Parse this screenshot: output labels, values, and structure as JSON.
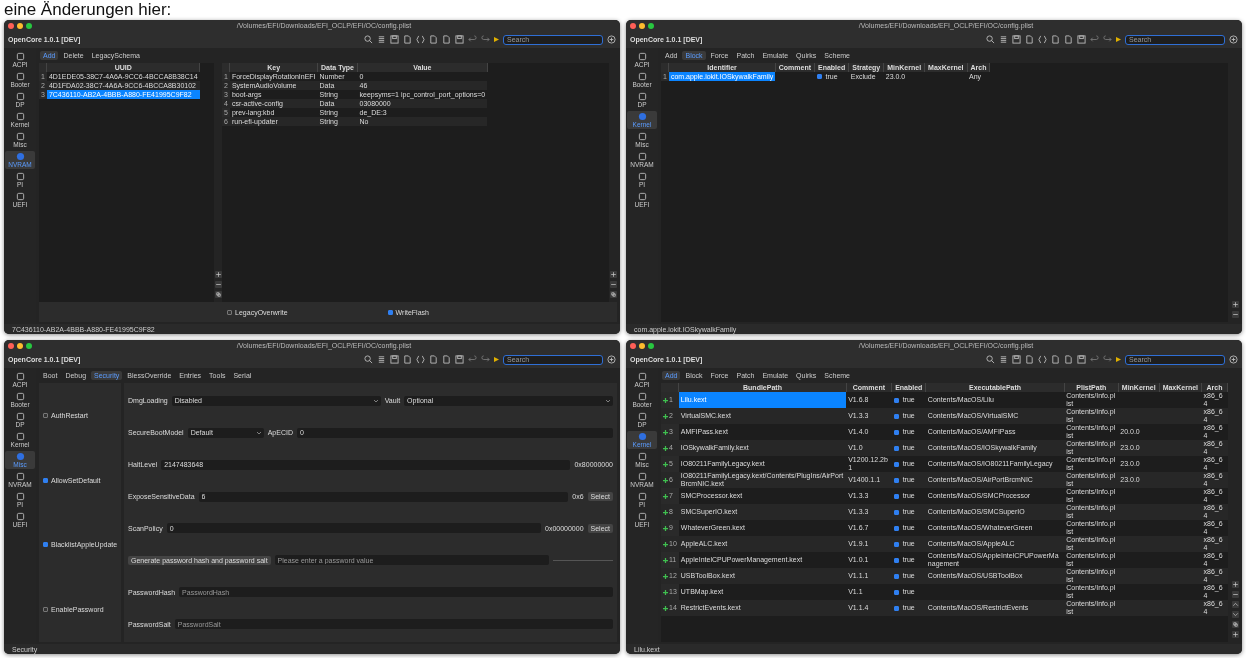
{
  "caption": "eine Änderungen hier:",
  "windows": [
    {
      "title": "/Volumes/EFI/Downloads/EFI_OCLP/EFI/OC/config.plist",
      "app_name": "OpenCore 1.0.1 [DEV]",
      "search_placeholder": "Search",
      "sidebar": [
        {
          "label": "ACPI",
          "selected": false
        },
        {
          "label": "Booter",
          "selected": false
        },
        {
          "label": "DP",
          "selected": false
        },
        {
          "label": "Kernel",
          "selected": false
        },
        {
          "label": "Misc",
          "selected": false
        },
        {
          "label": "NVRAM",
          "selected": true
        },
        {
          "label": "PI",
          "selected": false
        },
        {
          "label": "UEFI",
          "selected": false
        }
      ],
      "tabs": [
        {
          "label": "Add",
          "selected": true
        },
        {
          "label": "Delete",
          "selected": false
        },
        {
          "label": "LegacySchema",
          "selected": false
        }
      ],
      "kind": "nvram",
      "left_table": {
        "columns": [
          {
            "label": "UUID",
            "kind": "text"
          }
        ],
        "rows": [
          {
            "number": "1",
            "kind": "plain",
            "selected": false,
            "cells": [
              "4D1EDE05-38C7-4A6A-9CC6-4BCCA8B38C14"
            ]
          },
          {
            "number": "2",
            "kind": "plain",
            "selected": false,
            "cells": [
              "4D1FDA02-38C7-4A6A-9CC6-4BCCA8B30102"
            ]
          },
          {
            "number": "3",
            "kind": "plain",
            "selected": true,
            "cells": [
              "7C436110-AB2A-4BBB-A880-FE41995C9F82"
            ]
          }
        ]
      },
      "right_table": {
        "columns": [
          {
            "label": "Key",
            "kind": "text"
          },
          {
            "label": "Data Type",
            "kind": "text"
          },
          {
            "label": "Value",
            "kind": "text"
          }
        ],
        "rows": [
          {
            "number": "1",
            "kind": "plain",
            "selected": false,
            "cells": [
              "ForceDisplayRotationInEFI",
              "Number",
              "0"
            ]
          },
          {
            "number": "2",
            "kind": "plain",
            "selected": false,
            "cells": [
              "SystemAudioVolume",
              "Data",
              "46"
            ]
          },
          {
            "number": "3",
            "kind": "plain",
            "selected": false,
            "cells": [
              "boot-args",
              "String",
              "keepsyms=1 ipc_control_port_options=0"
            ]
          },
          {
            "number": "4",
            "kind": "plain",
            "selected": false,
            "cells": [
              "csr-active-config",
              "Data",
              "03080000"
            ]
          },
          {
            "number": "5",
            "kind": "plain",
            "selected": false,
            "cells": [
              "prev-lang:kbd",
              "String",
              "de_DE:3"
            ]
          },
          {
            "number": "6",
            "kind": "plain",
            "selected": false,
            "cells": [
              "run-efi-updater",
              "String",
              "No"
            ]
          }
        ]
      },
      "side_tools": [
        {
          "kind": "plus"
        },
        {
          "kind": "minus"
        },
        {
          "kind": "copy"
        }
      ],
      "footer_checks": [
        {
          "label": "LegacyOverwrite",
          "checked": false
        },
        {
          "label": "WriteFlash",
          "checked": true
        }
      ],
      "status": "7C436110-AB2A-4BBB-A880-FE41995C9F82"
    },
    {
      "title": "/Volumes/EFI/Downloads/EFI_OCLP/EFI/OC/config.plist",
      "app_name": "OpenCore 1.0.1 [DEV]",
      "search_placeholder": "Search",
      "sidebar": [
        {
          "label": "ACPI",
          "selected": false
        },
        {
          "label": "Booter",
          "selected": false
        },
        {
          "label": "DP",
          "selected": false
        },
        {
          "label": "Kernel",
          "selected": true
        },
        {
          "label": "Misc",
          "selected": false
        },
        {
          "label": "NVRAM",
          "selected": false
        },
        {
          "label": "PI",
          "selected": false
        },
        {
          "label": "UEFI",
          "selected": false
        }
      ],
      "tabs": [
        {
          "label": "Add",
          "selected": false
        },
        {
          "label": "Block",
          "selected": true
        },
        {
          "label": "Force",
          "selected": false
        },
        {
          "label": "Patch",
          "selected": false
        },
        {
          "label": "Emulate",
          "selected": false
        },
        {
          "label": "Quirks",
          "selected": false
        },
        {
          "label": "Scheme",
          "selected": false
        }
      ],
      "kind": "table",
      "table": {
        "columns": [
          {
            "label": "Identifier",
            "kind": "text"
          },
          {
            "label": "Comment",
            "kind": "text"
          },
          {
            "label": "Enabled",
            "kind": "check"
          },
          {
            "label": "Strategy",
            "kind": "text"
          },
          {
            "label": "MinKernel",
            "kind": "text"
          },
          {
            "label": "MaxKernel",
            "kind": "text"
          },
          {
            "label": "Arch",
            "kind": "text"
          }
        ],
        "rows": [
          {
            "number": "1",
            "kind": "plain",
            "selected": true,
            "checked": true,
            "cells": [
              "com.apple.iokit.IOSkywalkFamily",
              "",
              "true",
              "Exclude",
              "23.0.0",
              "",
              "Any"
            ]
          }
        ]
      },
      "side_tools": [
        {
          "kind": "plus"
        },
        {
          "kind": "minus"
        }
      ],
      "status": "com.apple.iokit.IOSkywalkFamily"
    },
    {
      "title": "/Volumes/EFI/Downloads/EFI_OCLP/EFI/OC/config.plist",
      "app_name": "OpenCore 1.0.1 [DEV]",
      "search_placeholder": "Search",
      "sidebar": [
        {
          "label": "ACPI",
          "selected": false
        },
        {
          "label": "Booter",
          "selected": false
        },
        {
          "label": "DP",
          "selected": false
        },
        {
          "label": "Kernel",
          "selected": false
        },
        {
          "label": "Misc",
          "selected": true
        },
        {
          "label": "NVRAM",
          "selected": false
        },
        {
          "label": "PI",
          "selected": false
        },
        {
          "label": "UEFI",
          "selected": false
        }
      ],
      "tabs": [
        {
          "label": "Boot",
          "selected": false
        },
        {
          "label": "Debug",
          "selected": false
        },
        {
          "label": "Security",
          "selected": true
        },
        {
          "label": "BlessOverride",
          "selected": false
        },
        {
          "label": "Entries",
          "selected": false
        },
        {
          "label": "Tools",
          "selected": false
        },
        {
          "label": "Serial",
          "selected": false
        }
      ],
      "kind": "form",
      "checks": [
        {
          "label": "AuthRestart",
          "checked": false
        },
        {
          "label": "AllowSetDefault",
          "checked": true
        },
        {
          "label": "BlacklistAppleUpdate",
          "checked": true
        },
        {
          "label": "EnablePassword",
          "checked": false
        }
      ],
      "form_rows": [
        [
          {
            "kind": "label",
            "text": "DmgLoading"
          },
          {
            "kind": "select",
            "text": "Disabled"
          },
          {
            "kind": "label",
            "text": "Vault"
          },
          {
            "kind": "select",
            "text": "Optional"
          }
        ],
        [
          {
            "kind": "label",
            "text": "SecureBootModel"
          },
          {
            "kind": "select_short",
            "text": "Default"
          },
          {
            "kind": "label",
            "text": "ApECID"
          },
          {
            "kind": "input",
            "text": "0"
          }
        ],
        [
          {
            "kind": "label",
            "text": "HaltLevel"
          },
          {
            "kind": "input",
            "text": "2147483648"
          },
          {
            "kind": "label",
            "text": "0x80000000"
          }
        ],
        [
          {
            "kind": "label",
            "text": "ExposeSensitiveData"
          },
          {
            "kind": "input",
            "text": "6"
          },
          {
            "kind": "label",
            "text": "0x6"
          },
          {
            "kind": "button",
            "text": "Select"
          }
        ],
        [
          {
            "kind": "label",
            "text": "ScanPolicy"
          },
          {
            "kind": "input",
            "text": "0"
          },
          {
            "kind": "label",
            "text": "0x00000000"
          },
          {
            "kind": "button",
            "text": "Select"
          }
        ],
        [
          {
            "kind": "button",
            "text": "Generate password hash and password salt"
          },
          {
            "kind": "input",
            "placeholder": "Please enter a password value"
          },
          {
            "kind": "rule"
          }
        ],
        [
          {
            "kind": "label",
            "text": "PasswordHash"
          },
          {
            "kind": "input",
            "placeholder": "PasswordHash"
          }
        ],
        [
          {
            "kind": "label",
            "text": "PasswordSalt"
          },
          {
            "kind": "input",
            "placeholder": "PasswordSalt"
          }
        ]
      ],
      "status": "Security"
    },
    {
      "title": "/Volumes/EFI/Downloads/EFI_OCLP/EFI/OC/config.plist",
      "app_name": "OpenCore 1.0.1 [DEV]",
      "search_placeholder": "Search",
      "sidebar": [
        {
          "label": "ACPI",
          "selected": false
        },
        {
          "label": "Booter",
          "selected": false
        },
        {
          "label": "DP",
          "selected": false
        },
        {
          "label": "Kernel",
          "selected": true
        },
        {
          "label": "Misc",
          "selected": false
        },
        {
          "label": "NVRAM",
          "selected": false
        },
        {
          "label": "PI",
          "selected": false
        },
        {
          "label": "UEFI",
          "selected": false
        }
      ],
      "tabs": [
        {
          "label": "Add",
          "selected": true
        },
        {
          "label": "Block",
          "selected": false
        },
        {
          "label": "Force",
          "selected": false
        },
        {
          "label": "Patch",
          "selected": false
        },
        {
          "label": "Emulate",
          "selected": false
        },
        {
          "label": "Quirks",
          "selected": false
        },
        {
          "label": "Scheme",
          "selected": false
        }
      ],
      "kind": "table",
      "table": {
        "columns": [
          {
            "label": "BundlePath",
            "kind": "text"
          },
          {
            "label": "Comment",
            "kind": "text"
          },
          {
            "label": "Enabled",
            "kind": "check"
          },
          {
            "label": "ExecutablePath",
            "kind": "text"
          },
          {
            "label": "PlistPath",
            "kind": "text"
          },
          {
            "label": "MinKernel",
            "kind": "text"
          },
          {
            "label": "MaxKernel",
            "kind": "text"
          },
          {
            "label": "Arch",
            "kind": "text"
          }
        ],
        "rows": [
          {
            "number": "1",
            "kind": "add",
            "selected": true,
            "checked": true,
            "cells": [
              "Lilu.kext",
              "V1.6.8",
              "true",
              "Contents/MacOS/Lilu",
              "Contents/Info.plist",
              "",
              "",
              "x86_64"
            ]
          },
          {
            "number": "2",
            "kind": "add",
            "selected": false,
            "checked": true,
            "cells": [
              "VirtualSMC.kext",
              "V1.3.3",
              "true",
              "Contents/MacOS/VirtualSMC",
              "Contents/Info.plist",
              "",
              "",
              "x86_64"
            ]
          },
          {
            "number": "3",
            "kind": "add",
            "selected": false,
            "checked": true,
            "cells": [
              "AMFIPass.kext",
              "V1.4.0",
              "true",
              "Contents/MacOS/AMFIPass",
              "Contents/Info.plist",
              "20.0.0",
              "",
              "x86_64"
            ]
          },
          {
            "number": "4",
            "kind": "add",
            "selected": false,
            "checked": true,
            "cells": [
              "IOSkywalkFamily.kext",
              "V1.0",
              "true",
              "Contents/MacOS/IOSkywalkFamily",
              "Contents/Info.plist",
              "23.0.0",
              "",
              "x86_64"
            ]
          },
          {
            "number": "5",
            "kind": "add",
            "selected": false,
            "checked": true,
            "cells": [
              "IO80211FamilyLegacy.kext",
              "V1200.12.2b1",
              "true",
              "Contents/MacOS/IO80211FamilyLegacy",
              "Contents/Info.plist",
              "23.0.0",
              "",
              "x86_64"
            ]
          },
          {
            "number": "6",
            "kind": "add",
            "selected": false,
            "checked": true,
            "cells": [
              "IO80211FamilyLegacy.kext/Contents/PlugIns/AirPortBrcmNIC.kext",
              "V1400.1.1",
              "true",
              "Contents/MacOS/AirPortBrcmNIC",
              "Contents/Info.plist",
              "23.0.0",
              "",
              "x86_64"
            ]
          },
          {
            "number": "7",
            "kind": "add",
            "selected": false,
            "checked": true,
            "cells": [
              "SMCProcessor.kext",
              "V1.3.3",
              "true",
              "Contents/MacOS/SMCProcessor",
              "Contents/Info.plist",
              "",
              "",
              "x86_64"
            ]
          },
          {
            "number": "8",
            "kind": "add",
            "selected": false,
            "checked": true,
            "cells": [
              "SMCSuperIO.kext",
              "V1.3.3",
              "true",
              "Contents/MacOS/SMCSuperIO",
              "Contents/Info.plist",
              "",
              "",
              "x86_64"
            ]
          },
          {
            "number": "9",
            "kind": "add",
            "selected": false,
            "checked": true,
            "cells": [
              "WhateverGreen.kext",
              "V1.6.7",
              "true",
              "Contents/MacOS/WhateverGreen",
              "Contents/Info.plist",
              "",
              "",
              "x86_64"
            ]
          },
          {
            "number": "10",
            "kind": "add",
            "selected": false,
            "checked": true,
            "cells": [
              "AppleALC.kext",
              "V1.9.1",
              "true",
              "Contents/MacOS/AppleALC",
              "Contents/Info.plist",
              "",
              "",
              "x86_64"
            ]
          },
          {
            "number": "11",
            "kind": "add",
            "selected": false,
            "checked": true,
            "cells": [
              "AppleIntelCPUPowerManagement.kext",
              "V1.0.1",
              "true",
              "Contents/MacOS/AppleIntelCPUPowerManagement",
              "Contents/Info.plist",
              "",
              "",
              "x86_64"
            ]
          },
          {
            "number": "12",
            "kind": "add",
            "selected": false,
            "checked": true,
            "cells": [
              "USBToolBox.kext",
              "V1.1.1",
              "true",
              "Contents/MacOS/USBToolBox",
              "Contents/Info.plist",
              "",
              "",
              "x86_64"
            ]
          },
          {
            "number": "13",
            "kind": "add",
            "selected": false,
            "checked": true,
            "cells": [
              "UTBMap.kext",
              "V1.1",
              "true",
              "",
              "Contents/Info.plist",
              "",
              "",
              "x86_64"
            ]
          },
          {
            "number": "14",
            "kind": "add",
            "selected": false,
            "checked": true,
            "cells": [
              "RestrictEvents.kext",
              "V1.1.4",
              "true",
              "Contents/MacOS/RestrictEvents",
              "Contents/Info.plist",
              "",
              "",
              "x86_64"
            ]
          }
        ]
      },
      "side_tools": [
        {
          "kind": "plus"
        },
        {
          "kind": "minus"
        },
        {
          "kind": "up"
        },
        {
          "kind": "down"
        },
        {
          "kind": "copy"
        },
        {
          "kind": "plus"
        }
      ],
      "status": "Lilu.kext"
    }
  ]
}
